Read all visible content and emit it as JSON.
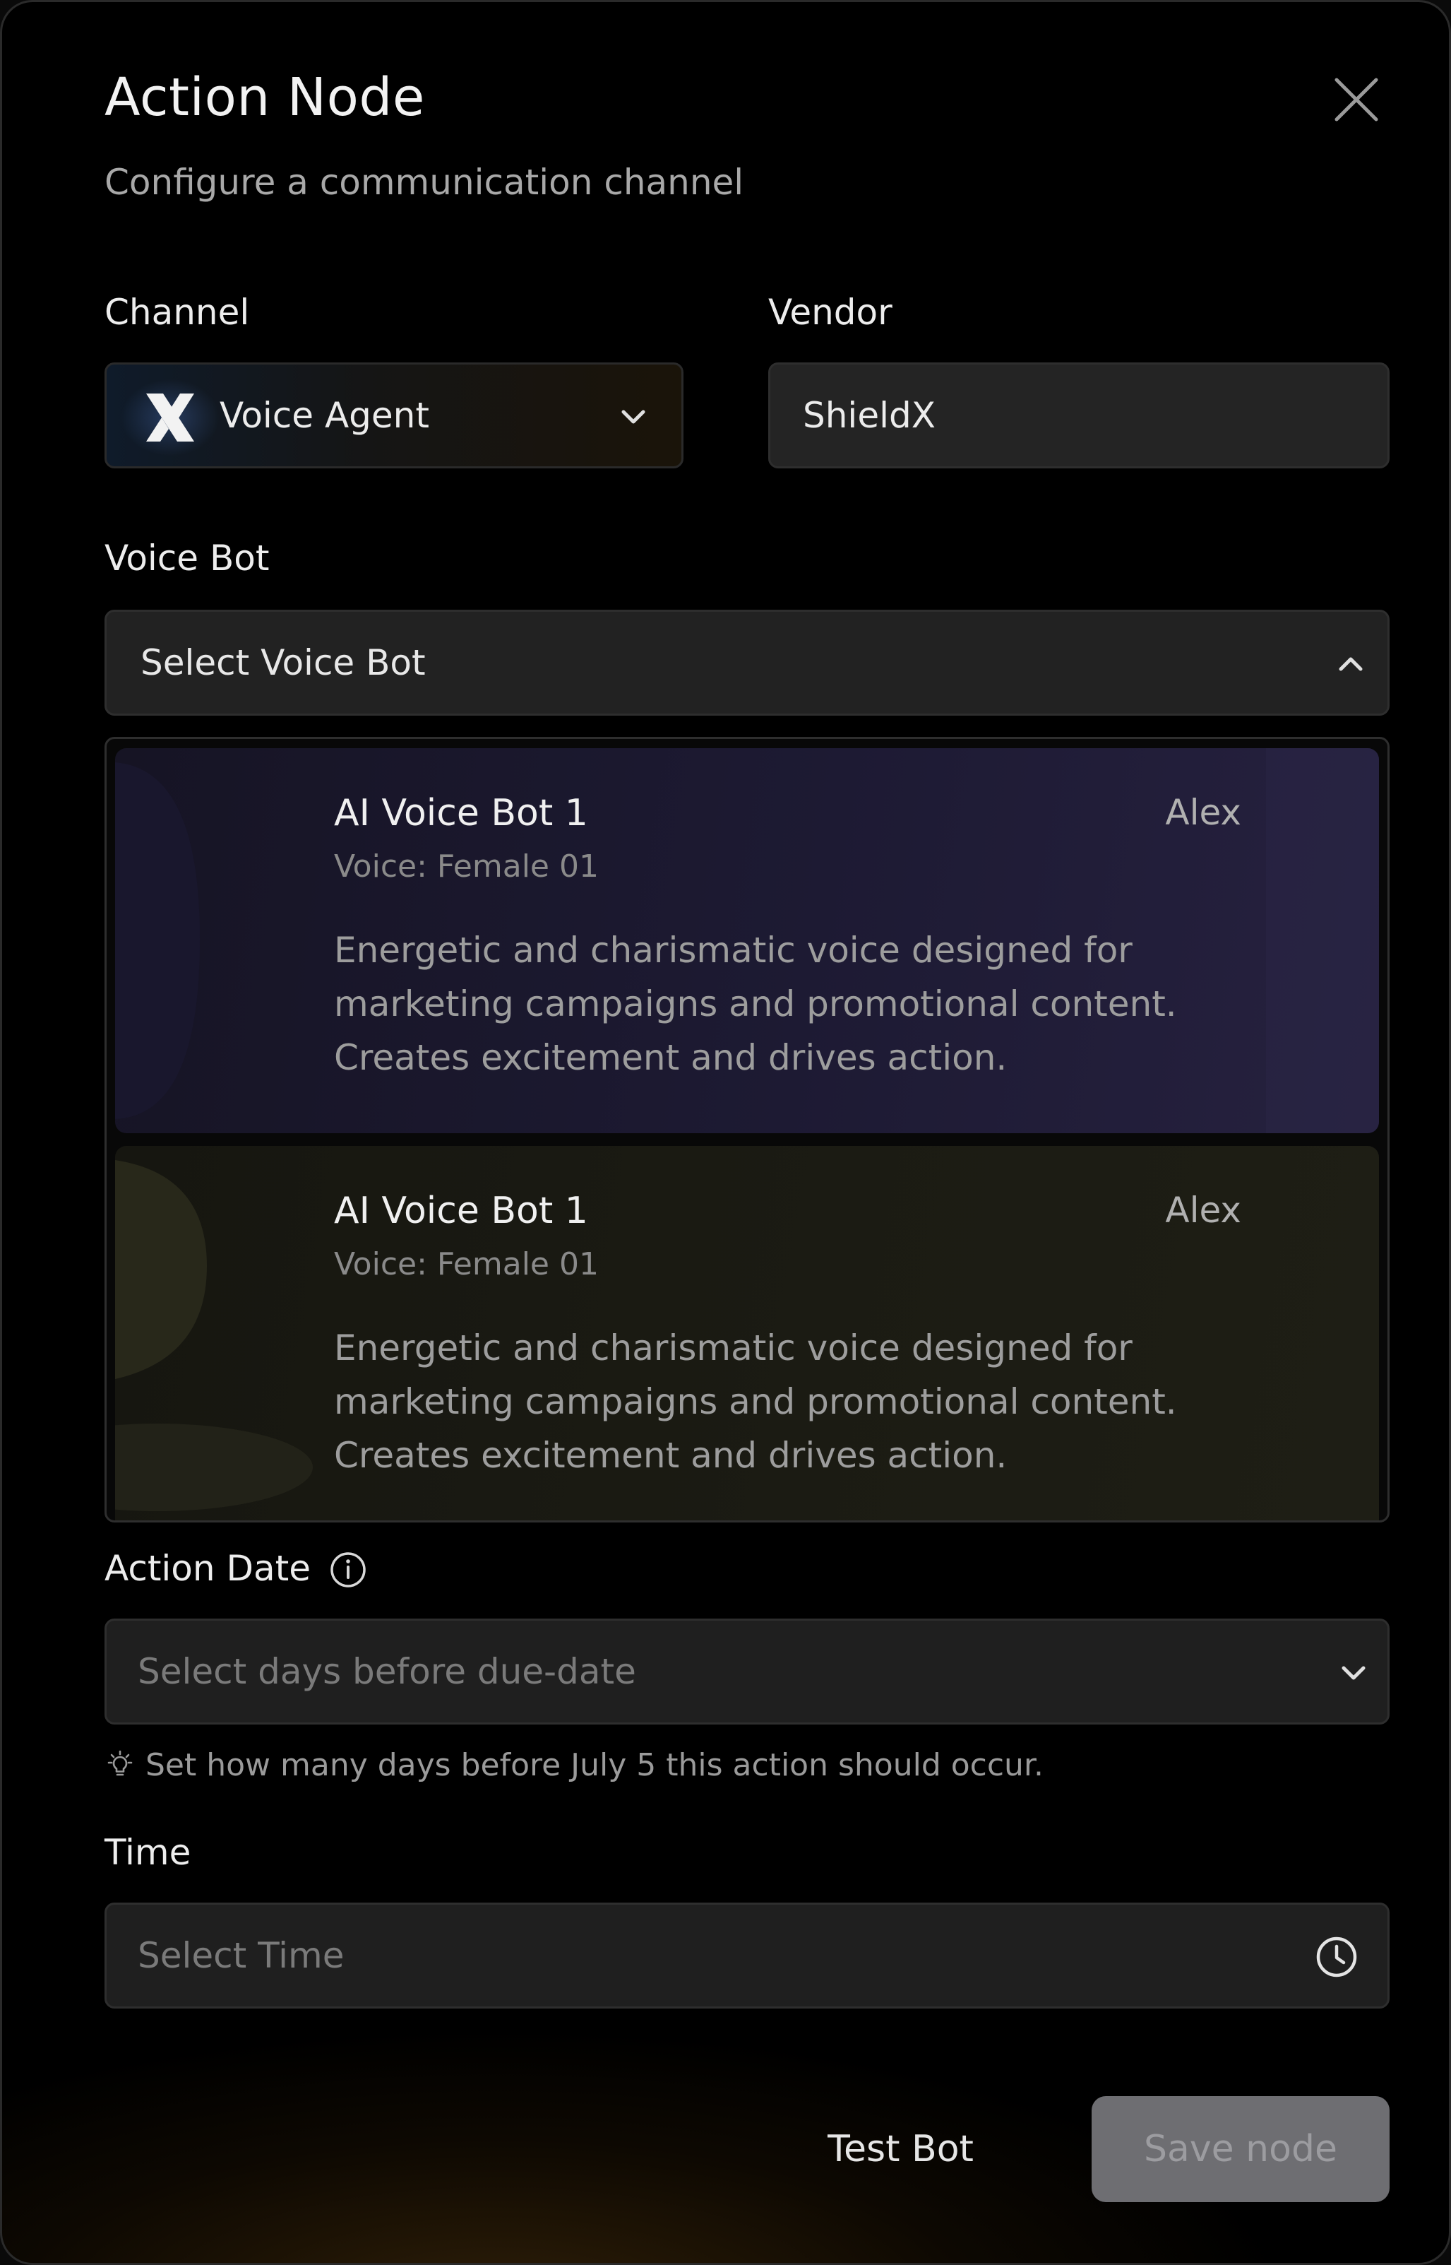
{
  "modal": {
    "title": "Action Node",
    "subtitle": "Configure a communication channel",
    "close_icon": "close-icon"
  },
  "channel": {
    "label": "Channel",
    "value": "Voice Agent",
    "icon": "voice-agent-x-logo",
    "chevron": "chevron-down-icon"
  },
  "vendor": {
    "label": "Vendor",
    "value": "ShieldX"
  },
  "voice_bot": {
    "label": "Voice Bot",
    "placeholder": "Select Voice Bot",
    "chevron": "chevron-up-icon",
    "expanded": true,
    "options": [
      {
        "title": "AI Voice Bot 1",
        "name": "Alex",
        "voice": "Voice: Female 01",
        "description": "Energetic and charismatic voice designed for marketing campaigns and promotional content. Creates excitement and drives action.",
        "accent": "#1d1a33"
      },
      {
        "title": "AI Voice Bot 1",
        "name": "Alex",
        "voice": "Voice: Female 01",
        "description": "Energetic and charismatic voice designed for marketing campaigns and promotional content. Creates excitement and drives action.",
        "accent": "#1b1b13"
      }
    ]
  },
  "action_date": {
    "label": "Action Date",
    "info_icon": "info-icon",
    "placeholder": "Select days before due-date",
    "chevron": "chevron-down-icon",
    "hint_icon": "lightbulb-icon",
    "hint": "Set how many days before July 5 this action should occur."
  },
  "time": {
    "label": "Time",
    "placeholder": "Select Time",
    "icon": "clock-icon"
  },
  "footer": {
    "test_label": "Test Bot",
    "save_label": "Save node",
    "save_disabled_color": "#6e6e72"
  }
}
